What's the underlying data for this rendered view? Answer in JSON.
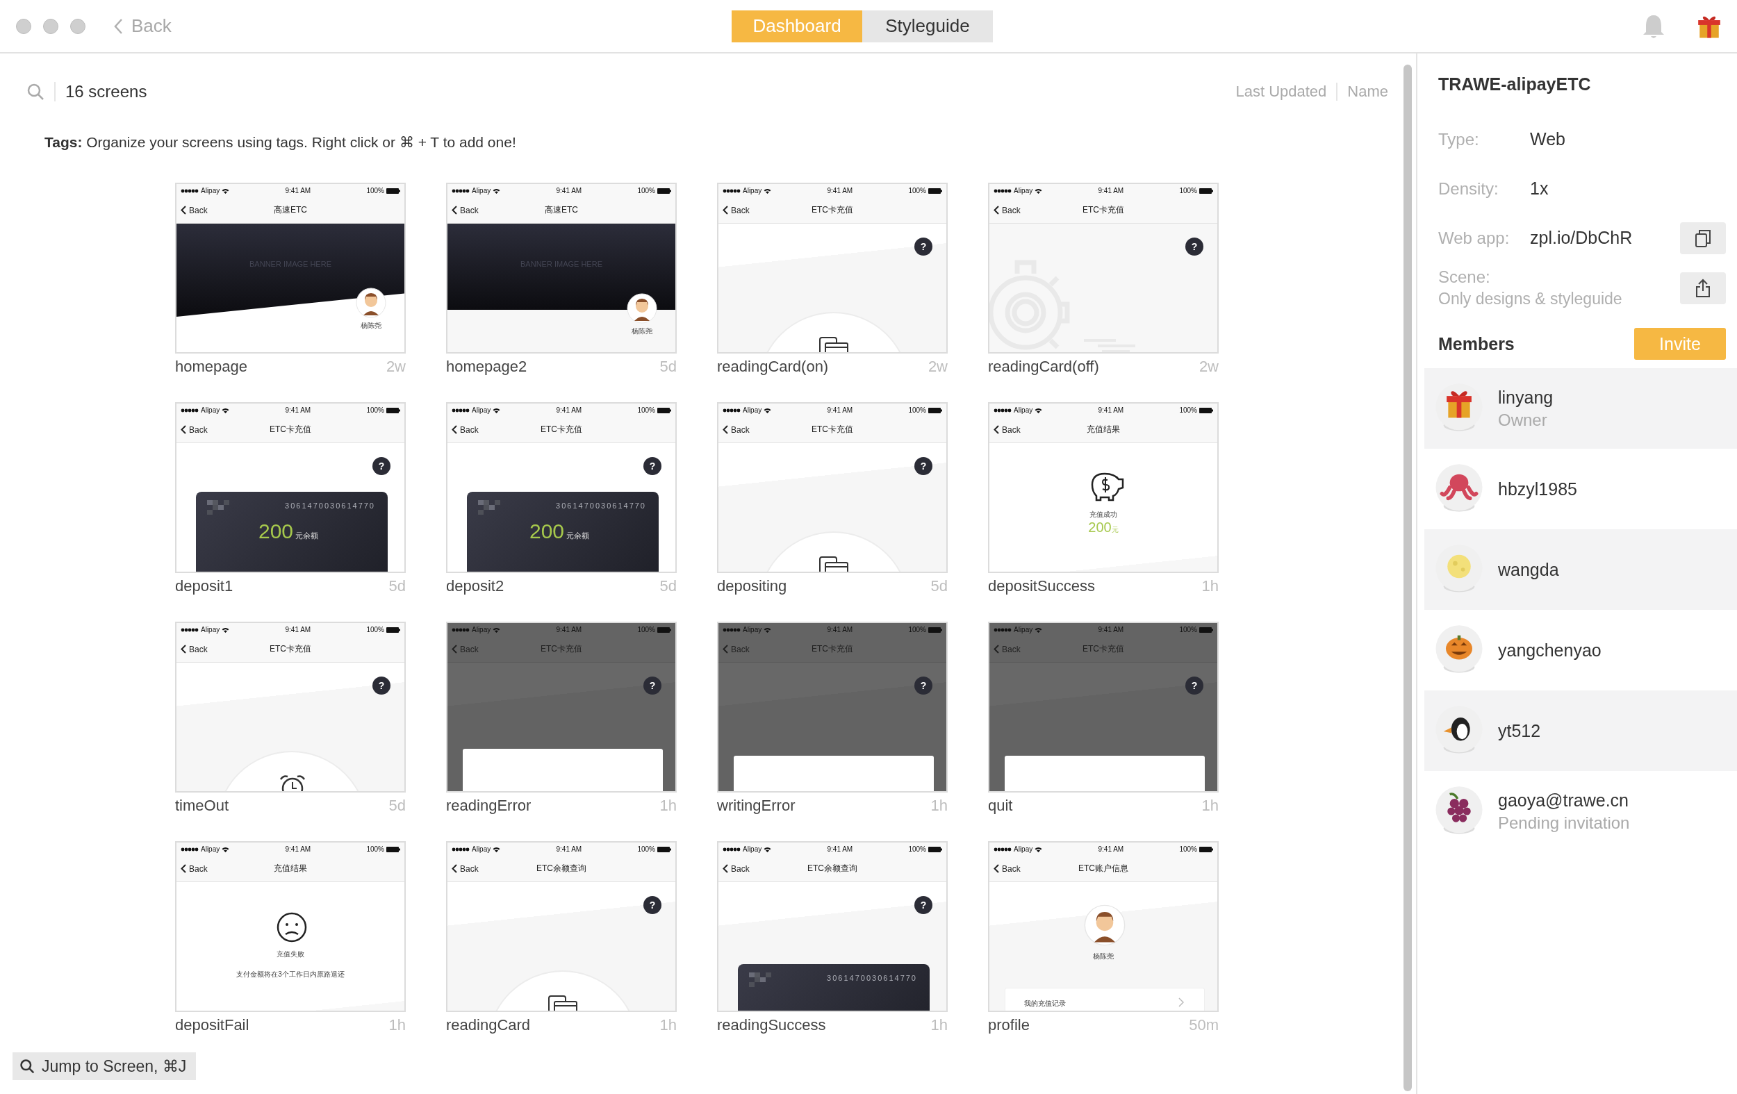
{
  "toolbar": {
    "back": "Back",
    "tabs": [
      {
        "label": "Dashboard",
        "selected": true
      },
      {
        "label": "Styleguide",
        "selected": false
      }
    ]
  },
  "screens_header": {
    "count": "16 screens",
    "sort_options": [
      "Last Updated",
      "Name"
    ]
  },
  "tags_hint": "**Tags:** Organize your screens using tags. Right click or ⌘ + T to add one!",
  "screens": [
    {
      "name": "homepage",
      "age": "2w",
      "kind": "banner",
      "status_bar": {
        "carrier": "Alipay",
        "time": "9:41 AM",
        "battery": "100%"
      },
      "back": "Back",
      "title": "高速ETC",
      "banner": "BANNER IMAGE HERE",
      "user": "杨陈尧",
      "slanted": true
    },
    {
      "name": "homepage2",
      "age": "5d",
      "kind": "banner",
      "status_bar": {
        "carrier": "Alipay",
        "time": "9:41 AM",
        "battery": "100%"
      },
      "back": "Back",
      "title": "高速ETC",
      "banner": "BANNER IMAGE HERE",
      "user": "杨陈尧",
      "slanted": false
    },
    {
      "name": "readingCard(on)",
      "age": "2w",
      "kind": "reader",
      "status_bar": {
        "carrier": "Alipay",
        "time": "9:41 AM",
        "battery": "100%"
      },
      "back": "Back",
      "title": "ETC卡充值",
      "help": "?"
    },
    {
      "name": "readingCard(off)",
      "age": "2w",
      "kind": "off",
      "status_bar": {
        "carrier": "Alipay",
        "time": "9:41 AM",
        "battery": "100%"
      },
      "back": "Back",
      "title": "ETC卡充值",
      "help": "?"
    },
    {
      "name": "deposit1",
      "age": "5d",
      "kind": "card",
      "status_bar": {
        "carrier": "Alipay",
        "time": "9:41 AM",
        "battery": "100%"
      },
      "back": "Back",
      "title": "ETC卡充值",
      "help": "?",
      "card_number": "3061470030614770",
      "amount": "200",
      "unit": "元余额"
    },
    {
      "name": "deposit2",
      "age": "5d",
      "kind": "card",
      "status_bar": {
        "carrier": "Alipay",
        "time": "9:41 AM",
        "battery": "100%"
      },
      "back": "Back",
      "title": "ETC卡充值",
      "help": "?",
      "card_number": "3061470030614770",
      "amount": "200",
      "unit": "元余额"
    },
    {
      "name": "depositing",
      "age": "5d",
      "kind": "reader",
      "status_bar": {
        "carrier": "Alipay",
        "time": "9:41 AM",
        "battery": "100%"
      },
      "back": "Back",
      "title": "ETC卡充值",
      "help": "?"
    },
    {
      "name": "depositSuccess",
      "age": "1h",
      "kind": "success",
      "status_bar": {
        "carrier": "Alipay",
        "time": "9:41 AM",
        "battery": "100%"
      },
      "back": "Back",
      "title": "充值结果",
      "message": "充值成功",
      "amount": "200",
      "unit": "元"
    },
    {
      "name": "timeOut",
      "age": "5d",
      "kind": "timeout",
      "status_bar": {
        "carrier": "Alipay",
        "time": "9:41 AM",
        "battery": "100%"
      },
      "back": "Back",
      "title": "ETC卡充值",
      "help": "?"
    },
    {
      "name": "readingError",
      "age": "1h",
      "kind": "dialog",
      "status_bar": {
        "carrier": "Alipay",
        "time": "9:41 AM",
        "battery": "100%"
      },
      "back": "Back",
      "title": "ETC卡充值",
      "help": "?"
    },
    {
      "name": "writingError",
      "age": "1h",
      "kind": "dialog",
      "status_bar": {
        "carrier": "Alipay",
        "time": "9:41 AM",
        "battery": "100%"
      },
      "back": "Back",
      "title": "ETC卡充值",
      "help": "?"
    },
    {
      "name": "quit",
      "age": "1h",
      "kind": "dialog",
      "status_bar": {
        "carrier": "Alipay",
        "time": "9:41 AM",
        "battery": "100%"
      },
      "back": "Back",
      "title": "ETC卡充值",
      "help": "?"
    },
    {
      "name": "depositFail",
      "age": "1h",
      "kind": "fail",
      "status_bar": {
        "carrier": "Alipay",
        "time": "9:41 AM",
        "battery": "100%"
      },
      "back": "Back",
      "title": "充值结果",
      "message": "充值失败",
      "note": "支付金额将在3个工作日内原路退还"
    },
    {
      "name": "readingCard",
      "age": "1h",
      "kind": "reader",
      "status_bar": {
        "carrier": "Alipay",
        "time": "9:41 AM",
        "battery": "100%"
      },
      "back": "Back",
      "title": "ETC余额查询",
      "help": "?"
    },
    {
      "name": "readingSuccess",
      "age": "1h",
      "kind": "card_peek",
      "status_bar": {
        "carrier": "Alipay",
        "time": "9:41 AM",
        "battery": "100%"
      },
      "back": "Back",
      "title": "ETC余额查询",
      "help": "?",
      "card_number": "3061470030614770"
    },
    {
      "name": "profile",
      "age": "50m",
      "kind": "profile",
      "status_bar": {
        "carrier": "Alipay",
        "time": "9:41 AM",
        "battery": "100%"
      },
      "back": "Back",
      "title": "ETC账户信息",
      "user": "杨陈尧",
      "link": "我的充值记录"
    }
  ],
  "jump_button": "Jump to Screen, ⌘J",
  "project": {
    "title": "TRAWE-alipayETC",
    "fields": [
      {
        "label": "Type:",
        "value": "Web",
        "kind": "plain"
      },
      {
        "label": "Density:",
        "value": "1x",
        "kind": "plain"
      },
      {
        "label": "Web app:",
        "value": "zpl.io/DbChR",
        "kind": "copy"
      },
      {
        "label": "Scene:",
        "value": "Only designs & styleguide",
        "kind": "share"
      }
    ]
  },
  "members": {
    "title": "Members",
    "invite": "Invite",
    "list": [
      {
        "name": "linyang",
        "role": "Owner"
      },
      {
        "name": "hbzyl1985"
      },
      {
        "name": "wangda"
      },
      {
        "name": "yangchenyao"
      },
      {
        "name": "yt512"
      },
      {
        "name": "gaoya@trawe.cn",
        "role": "Pending invitation"
      }
    ]
  }
}
